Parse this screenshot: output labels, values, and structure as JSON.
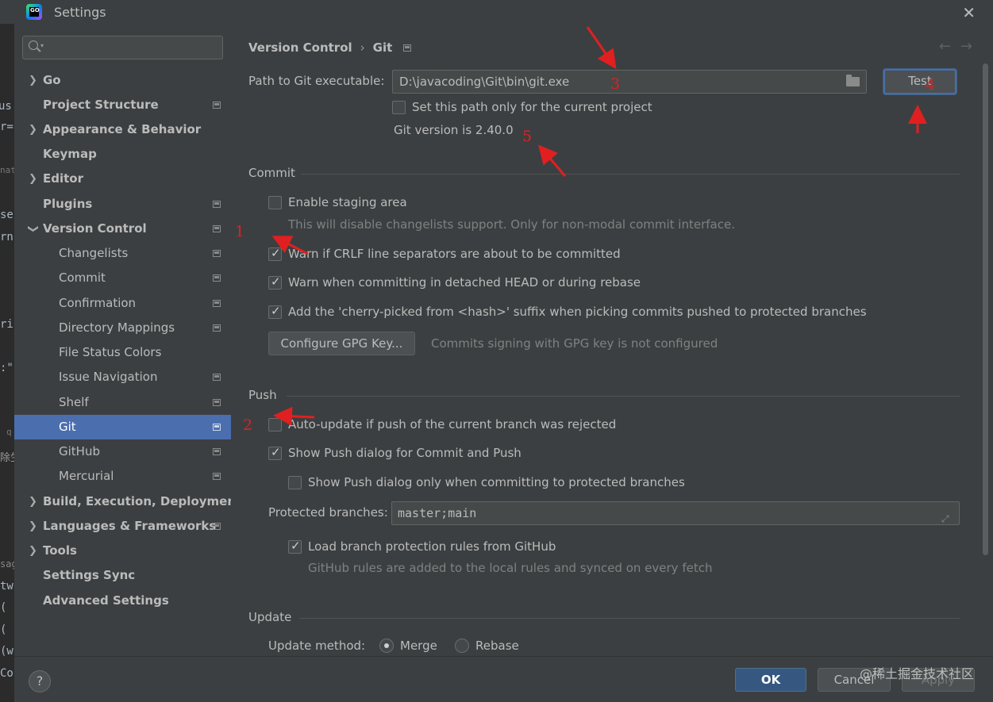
{
  "window": {
    "title": "Settings"
  },
  "search": {
    "placeholder": ""
  },
  "sidebar": {
    "items": [
      {
        "label": "Go"
      },
      {
        "label": "Project Structure"
      },
      {
        "label": "Appearance & Behavior"
      },
      {
        "label": "Keymap"
      },
      {
        "label": "Editor"
      },
      {
        "label": "Plugins"
      },
      {
        "label": "Version Control"
      },
      {
        "label": "Changelists"
      },
      {
        "label": "Commit"
      },
      {
        "label": "Confirmation"
      },
      {
        "label": "Directory Mappings"
      },
      {
        "label": "File Status Colors"
      },
      {
        "label": "Issue Navigation"
      },
      {
        "label": "Shelf"
      },
      {
        "label": "Git"
      },
      {
        "label": "GitHub"
      },
      {
        "label": "Mercurial"
      },
      {
        "label": "Build, Execution, Deployment"
      },
      {
        "label": "Languages & Frameworks"
      },
      {
        "label": "Tools"
      },
      {
        "label": "Settings Sync"
      },
      {
        "label": "Advanced Settings"
      }
    ],
    "selected": "Git"
  },
  "breadcrumb": {
    "parent": "Version Control",
    "current": "Git"
  },
  "git": {
    "path_label": "Path to Git executable:",
    "path_value": "D:\\javacoding\\Git\\bin\\git.exe",
    "test_button": "Test",
    "project_only_label": "Set this path only for the current project",
    "version_text": "Git version is 2.40.0"
  },
  "commit": {
    "section_title": "Commit",
    "staging_label": "Enable staging area",
    "staging_hint": "This will disable changelists support. Only for non-modal commit interface.",
    "crlf_label": "Warn if CRLF line separators are about to be committed",
    "detached_label": "Warn when committing in detached HEAD or during rebase",
    "cherry_label": "Add the 'cherry-picked from <hash>' suffix when picking commits pushed to protected branches",
    "gpg_button": "Configure GPG Key...",
    "gpg_status": "Commits signing with GPG key is not configured"
  },
  "push": {
    "section_title": "Push",
    "autoupdate_label": "Auto-update if push of the current branch was rejected",
    "show_dialog_label": "Show Push dialog for Commit and Push",
    "show_protected_label": "Show Push dialog only when committing to protected branches",
    "protected_label": "Protected branches:",
    "protected_value": "master;main",
    "load_rules_label": "Load branch protection rules from GitHub",
    "load_rules_hint": "GitHub rules are added to the local rules and synced on every fetch"
  },
  "update": {
    "section_title": "Update",
    "method_label": "Update method:",
    "merge_label": "Merge",
    "rebase_label": "Rebase"
  },
  "footer": {
    "help": "?",
    "ok": "OK",
    "cancel": "Cancel",
    "apply": "Apply"
  },
  "annotations": [
    "1",
    "2",
    "3",
    "4",
    "5"
  ],
  "watermark": "@稀土掘金技术社区",
  "bg_editor_fragments": [
    "r",
    "us",
    "r=",
    "nat",
    "se",
    "rn",
    "ri",
    ":\"",
    "q",
    "除生",
    "sag",
    "tw",
    "(",
    "(",
    "(w",
    "Co"
  ],
  "colors": {
    "selection": "#4b6eaf",
    "primary_button": "#365880",
    "annotation": "#e02020",
    "panel": "#3c3f41"
  }
}
